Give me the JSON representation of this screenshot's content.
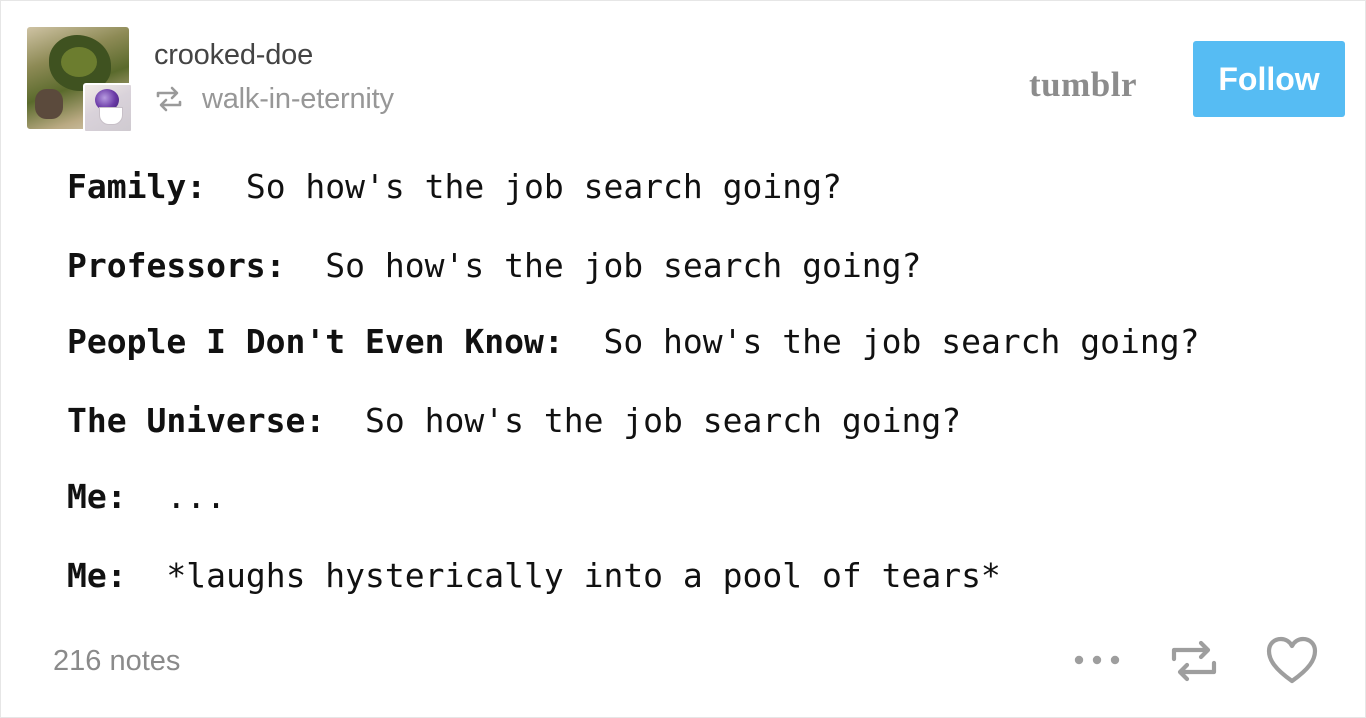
{
  "post": {
    "blog_name": "crooked-doe",
    "reblogged_from": "walk-in-eternity",
    "brand": "tumblr",
    "follow_label": "Follow",
    "lines": [
      {
        "speaker": "Family:",
        "text": "So how's the job search going?"
      },
      {
        "speaker": "Professors:",
        "text": "So how's the job search going?"
      },
      {
        "speaker": "People I Don't Even Know:",
        "text": "So how's the job search going?"
      },
      {
        "speaker": "The Universe:",
        "text": "So how's the job search going?"
      },
      {
        "speaker": "Me:",
        "text": "..."
      },
      {
        "speaker": "Me:",
        "text": "*laughs hysterically into a pool of tears*"
      }
    ],
    "notes": "216 notes"
  },
  "colors": {
    "follow_bg": "#56bcf3",
    "brand_text": "#8c8c8c",
    "secondary_text": "#979797"
  },
  "icons": [
    "reblog-icon",
    "more-icon",
    "heart-icon"
  ]
}
